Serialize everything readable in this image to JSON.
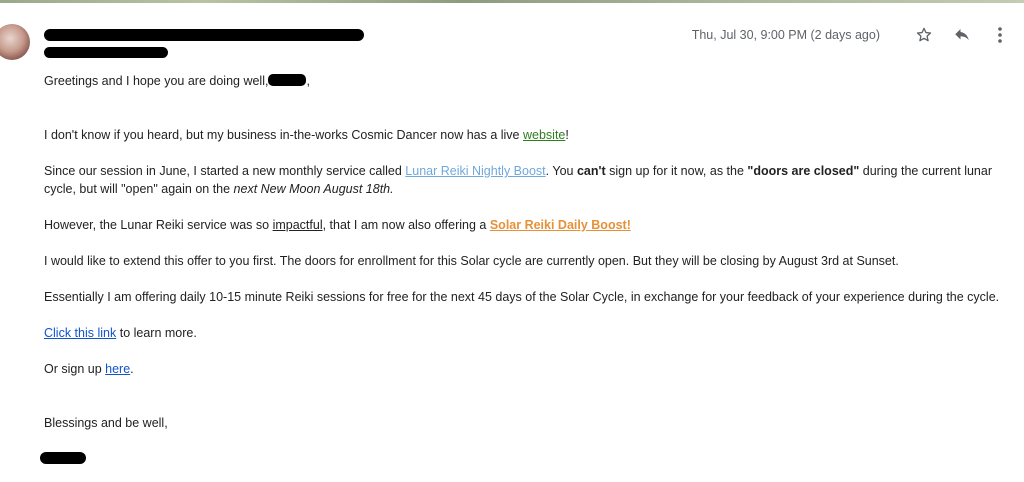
{
  "header": {
    "date": "Thu, Jul 30, 9:00 PM (2 days ago)",
    "star_icon": "star-outline-icon",
    "reply_icon": "reply-icon",
    "more_icon": "more-vertical-icon"
  },
  "message": {
    "greeting_prefix": "Greetings and I hope you are doing well,",
    "greeting_suffix": ",",
    "p1_prefix": "I don't know if you heard, but my business in-the-works Cosmic Dancer now has a live ",
    "p1_link": "website",
    "p1_suffix": "!",
    "p2_a": "Since our session in June, I started a new monthly service called ",
    "p2_link": "Lunar Reiki Nightly Boost",
    "p2_b": ".  You ",
    "p2_bold1": "can't",
    "p2_c": " sign up for it now, as the ",
    "p2_bold2": "\"doors are closed\"",
    "p2_d": " during the current lunar cycle, but will \"open\" again on the ",
    "p2_italic": "next New Moon August 18th.",
    "p3_a": "However, the Lunar Reiki service was so ",
    "p3_underline": "impactful",
    "p3_b": ", that I am now also offering a ",
    "p3_link": "Solar Reiki Daily Boost!",
    "p4": "I would like to extend this offer to you first.  The doors for enrollment for this Solar cycle are currently open.  But they will be closing by August 3rd at Sunset.",
    "p5": "Essentially I am offering daily 10-15 minute Reiki sessions for free for the next 45 days of the Solar Cycle, in exchange for your feedback of your experience during the cycle.",
    "p6_link": "Click this link",
    "p6_suffix": " to learn more.",
    "p7_prefix": "Or sign up ",
    "p7_link": "here",
    "p7_suffix": ".",
    "closing": "Blessings and be well,"
  },
  "colors": {
    "green_link": "#2f7d1f",
    "lightblue_link": "#6fa8dc",
    "orange_link": "#e69138",
    "blue_link": "#1155cc",
    "date_gray": "#5f6368"
  }
}
